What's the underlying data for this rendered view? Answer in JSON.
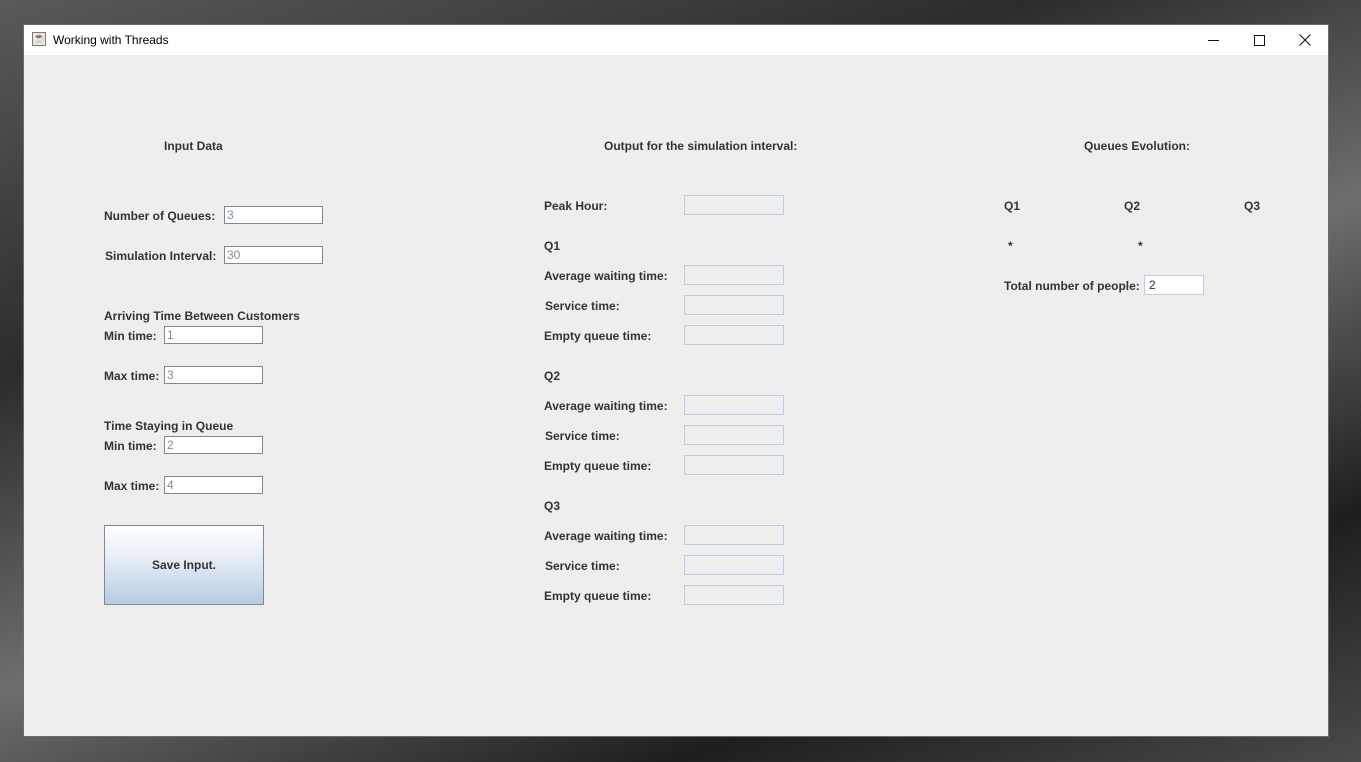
{
  "window": {
    "title": "Working with Threads"
  },
  "input": {
    "heading": "Input Data",
    "num_queues_label": "Number of Queues:",
    "num_queues_value": "3",
    "sim_interval_label": "Simulation Interval:",
    "sim_interval_value": "30",
    "arriving_heading": "Arriving Time Between Customers",
    "arriving_min_label": "Min time:",
    "arriving_min_value": "1",
    "arriving_max_label": "Max time:",
    "arriving_max_value": "3",
    "staying_heading": "Time Staying in Queue",
    "staying_min_label": "Min time:",
    "staying_min_value": "2",
    "staying_max_label": "Max time:",
    "staying_max_value": "4",
    "save_label": "Save Input."
  },
  "output": {
    "heading": "Output for the simulation interval:",
    "peak_hour_label": "Peak Hour:",
    "peak_hour_value": "",
    "queues": [
      {
        "name": "Q1",
        "avg_label": "Average waiting time:",
        "avg_value": "",
        "service_label": "Service time:",
        "service_value": "",
        "empty_label": "Empty queue time:",
        "empty_value": ""
      },
      {
        "name": "Q2",
        "avg_label": "Average waiting time:",
        "avg_value": "",
        "service_label": "Service time:",
        "service_value": "",
        "empty_label": "Empty queue time:",
        "empty_value": ""
      },
      {
        "name": "Q3",
        "avg_label": "Average waiting time:",
        "avg_value": "",
        "service_label": "Service time:",
        "service_value": "",
        "empty_label": "Empty queue time:",
        "empty_value": ""
      }
    ]
  },
  "evolution": {
    "heading": "Queues Evolution:",
    "queues": [
      {
        "name": "Q1",
        "content": "*"
      },
      {
        "name": "Q2",
        "content": "*"
      },
      {
        "name": "Q3",
        "content": ""
      }
    ],
    "total_label": "Total number of people:",
    "total_value": "2"
  }
}
